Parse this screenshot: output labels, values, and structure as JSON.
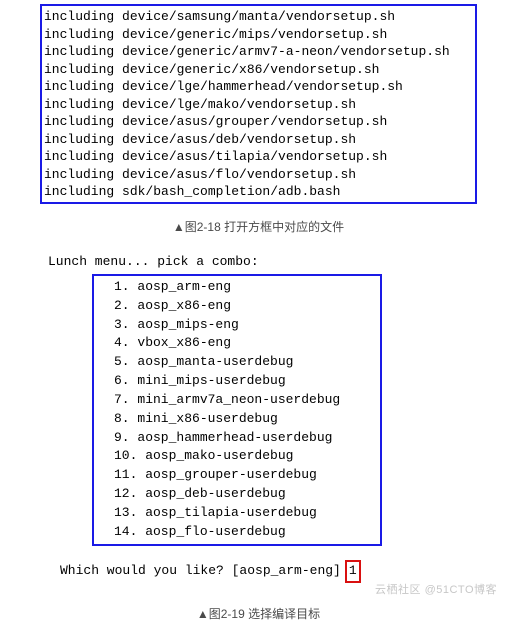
{
  "terminal_output": {
    "lines": [
      "including device/samsung/manta/vendorsetup.sh",
      "including device/generic/mips/vendorsetup.sh",
      "including device/generic/armv7-a-neon/vendorsetup.sh",
      "including device/generic/x86/vendorsetup.sh",
      "including device/lge/hammerhead/vendorsetup.sh",
      "including device/lge/mako/vendorsetup.sh",
      "including device/asus/grouper/vendorsetup.sh",
      "including device/asus/deb/vendorsetup.sh",
      "including device/asus/tilapia/vendorsetup.sh",
      "including device/asus/flo/vendorsetup.sh",
      "including sdk/bash_completion/adb.bash"
    ]
  },
  "caption1": "▲图2-18 打开方框中对应的文件",
  "lunch": {
    "header": "Lunch menu... pick a combo:",
    "items": [
      "1. aosp_arm-eng",
      "2. aosp_x86-eng",
      "3. aosp_mips-eng",
      "4. vbox_x86-eng",
      "5. aosp_manta-userdebug",
      "6. mini_mips-userdebug",
      "7. mini_armv7a_neon-userdebug",
      "8. mini_x86-userdebug",
      "9. aosp_hammerhead-userdebug",
      "10. aosp_mako-userdebug",
      "11. aosp_grouper-userdebug",
      "12. aosp_deb-userdebug",
      "13. aosp_tilapia-userdebug",
      "14. aosp_flo-userdebug"
    ],
    "prompt": "Which would you like? [aosp_arm-eng]",
    "input_value": "1"
  },
  "caption2": "▲图2-19 选择编译目标",
  "watermark": "云栖社区  @51CTO博客"
}
